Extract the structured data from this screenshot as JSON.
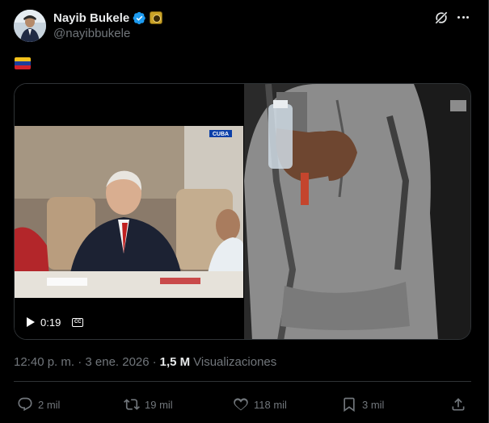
{
  "author": {
    "display_name": "Nayib Bukele",
    "handle": "@nayibbukele",
    "verified": true
  },
  "post": {
    "text_emoji": "venezuela-flag",
    "media": {
      "type": "video",
      "duration": "0:19",
      "left_overlay_label": "CUBA"
    },
    "timestamp": "12:40 p. m. · 3 ene. 2026",
    "views_count": "1,5 M",
    "views_label": "Visualizaciones"
  },
  "actions": {
    "replies": "2 mil",
    "reposts": "19 mil",
    "likes": "118 mil",
    "bookmarks": "3 mil"
  },
  "colors": {
    "background": "#000000",
    "text_primary": "#e7e9ea",
    "text_secondary": "#71767b",
    "verified_blue": "#1d9bf0",
    "divider": "#2f3336"
  }
}
